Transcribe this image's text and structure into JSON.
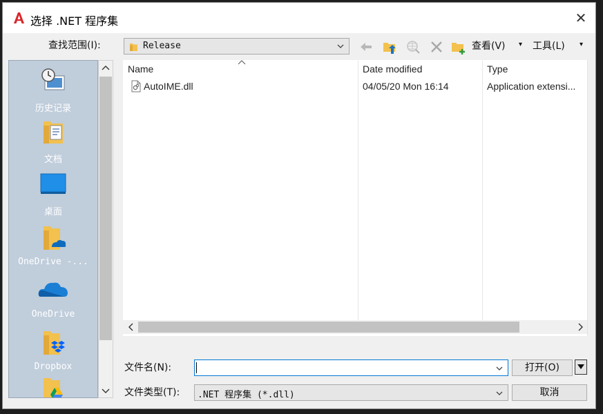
{
  "window": {
    "title": "选择 .NET 程序集",
    "close_glyph": "✕"
  },
  "toolbar": {
    "look_in_label": "查找范围(I):",
    "look_in_value": "Release",
    "views_label": "查看(V)",
    "tools_label": "工具(L)",
    "caret": "▾"
  },
  "places": {
    "items": [
      {
        "label": "历史记录",
        "icon": "history-icon"
      },
      {
        "label": "文档",
        "icon": "documents-folder-icon"
      },
      {
        "label": "桌面",
        "icon": "desktop-icon"
      },
      {
        "label": "OneDrive -...",
        "icon": "onedrive-folder-icon"
      },
      {
        "label": "OneDrive",
        "icon": "onedrive-cloud-icon"
      },
      {
        "label": "Dropbox",
        "icon": "dropbox-folder-icon"
      },
      {
        "label": "",
        "icon": "google-drive-folder-icon"
      }
    ]
  },
  "file_list": {
    "columns": [
      "Name",
      "Date modified",
      "Type"
    ],
    "rows": [
      {
        "name": "AutoIME.dll",
        "date": "04/05/20 Mon 16:14",
        "type": "Application extensi..."
      }
    ]
  },
  "bottom": {
    "filename_label": "文件名(N):",
    "filename_value": "",
    "filetype_label": "文件类型(T):",
    "filetype_value": ".NET 程序集 (*.dll)",
    "open_label": "打开(O)",
    "cancel_label": "取消"
  },
  "colors": {
    "accent": "#0078d7",
    "places_bg": "#c0cddb",
    "folder": "#f2c14e",
    "logo_red": "#d9262b"
  }
}
